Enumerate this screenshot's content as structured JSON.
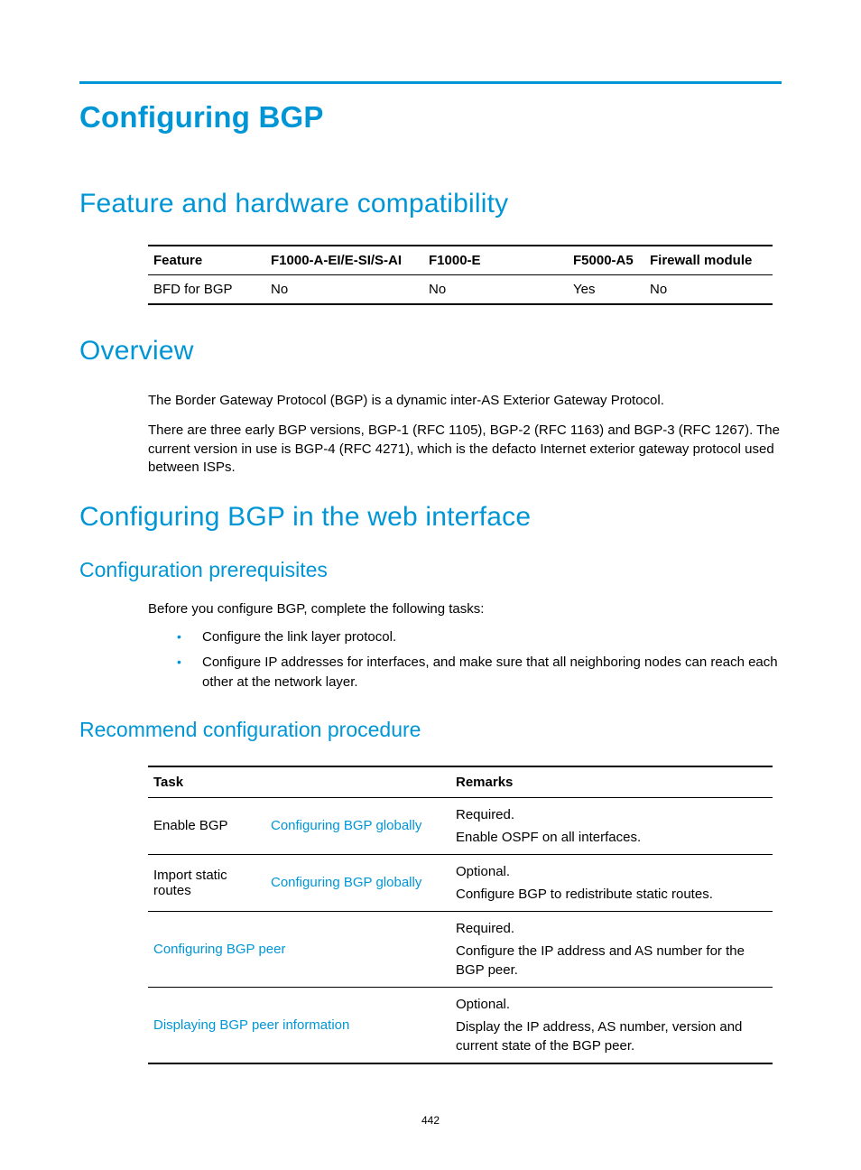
{
  "title": "Configuring BGP",
  "sections": {
    "feature_heading": "Feature and hardware compatibility",
    "overview_heading": "Overview",
    "webcfg_heading": "Configuring BGP in the web interface",
    "prereq_heading": "Configuration prerequisites",
    "recommend_heading": "Recommend configuration procedure"
  },
  "feature_table": {
    "headers": [
      "Feature",
      "F1000-A-EI/E-SI/S-AI",
      "F1000-E",
      "F5000-A5",
      "Firewall module"
    ],
    "rows": [
      [
        "BFD for BGP",
        "No",
        "No",
        "Yes",
        "No"
      ]
    ]
  },
  "overview": {
    "p1": "The Border Gateway Protocol (BGP) is a dynamic inter-AS Exterior Gateway Protocol.",
    "p2": "There are three early BGP versions, BGP-1 (RFC 1105), BGP-2 (RFC 1163) and BGP-3 (RFC 1267). The current version in use is BGP-4 (RFC 4271), which is the defacto Internet exterior gateway protocol used between ISPs."
  },
  "prereq": {
    "intro": "Before you configure BGP, complete the following tasks:",
    "items": [
      "Configure the link layer protocol.",
      "Configure IP addresses for interfaces, and make sure that all neighboring nodes can reach each other at the network layer."
    ]
  },
  "proc_table": {
    "headers": [
      "Task",
      "Remarks"
    ],
    "rows": [
      {
        "task_a": "Enable BGP",
        "task_b": "Configuring BGP globally",
        "task_b_link": true,
        "span": false,
        "remarks": [
          "Required.",
          "Enable OSPF on all interfaces."
        ]
      },
      {
        "task_a": "Import static routes",
        "task_b": "Configuring BGP globally",
        "task_b_link": true,
        "span": false,
        "remarks": [
          "Optional.",
          "Configure BGP to redistribute static routes."
        ]
      },
      {
        "task_a": "Configuring BGP peer",
        "task_a_link": true,
        "span": true,
        "remarks": [
          "Required.",
          "Configure the IP address and AS number for the BGP peer."
        ]
      },
      {
        "task_a": "Displaying BGP peer information",
        "task_a_link": true,
        "span": true,
        "remarks": [
          "Optional.",
          "Display the IP address, AS number, version and current state of the BGP peer."
        ]
      }
    ]
  },
  "page_number": "442"
}
